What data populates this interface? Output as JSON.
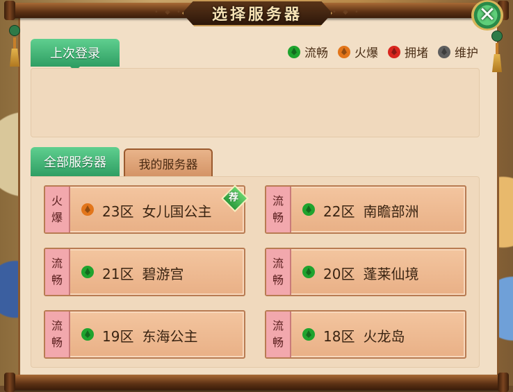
{
  "title": "选择服务器",
  "title_deco_left": "• ◆ •",
  "title_deco_right": "• ◆ •",
  "close_icon": "close-x-icon",
  "close_label": "✕",
  "last_login_tab": "上次登录",
  "legend": [
    {
      "label": "流畅",
      "color": "#1fa32e"
    },
    {
      "label": "火爆",
      "color": "#e2751a"
    },
    {
      "label": "拥堵",
      "color": "#d8261f"
    },
    {
      "label": "维护",
      "color": "#5e5e5e"
    }
  ],
  "tabs": {
    "all": "全部服务器",
    "mine": "我的服务器"
  },
  "servers": [
    {
      "status_top": "火",
      "status_bottom": "爆",
      "zone": "23区",
      "name": "女儿国公主",
      "color": "#e2751a",
      "badge": "荐"
    },
    {
      "status_top": "流",
      "status_bottom": "畅",
      "zone": "22区",
      "name": "南瞻部洲",
      "color": "#1fa32e",
      "badge": ""
    },
    {
      "status_top": "流",
      "status_bottom": "畅",
      "zone": "21区",
      "name": "碧游宫",
      "color": "#1fa32e",
      "badge": ""
    },
    {
      "status_top": "流",
      "status_bottom": "畅",
      "zone": "20区",
      "name": "蓬莱仙境",
      "color": "#1fa32e",
      "badge": ""
    },
    {
      "status_top": "流",
      "status_bottom": "畅",
      "zone": "19区",
      "name": "东海公主",
      "color": "#1fa32e",
      "badge": ""
    },
    {
      "status_top": "流",
      "status_bottom": "畅",
      "zone": "18区",
      "name": "火龙岛",
      "color": "#1fa32e",
      "badge": ""
    }
  ]
}
